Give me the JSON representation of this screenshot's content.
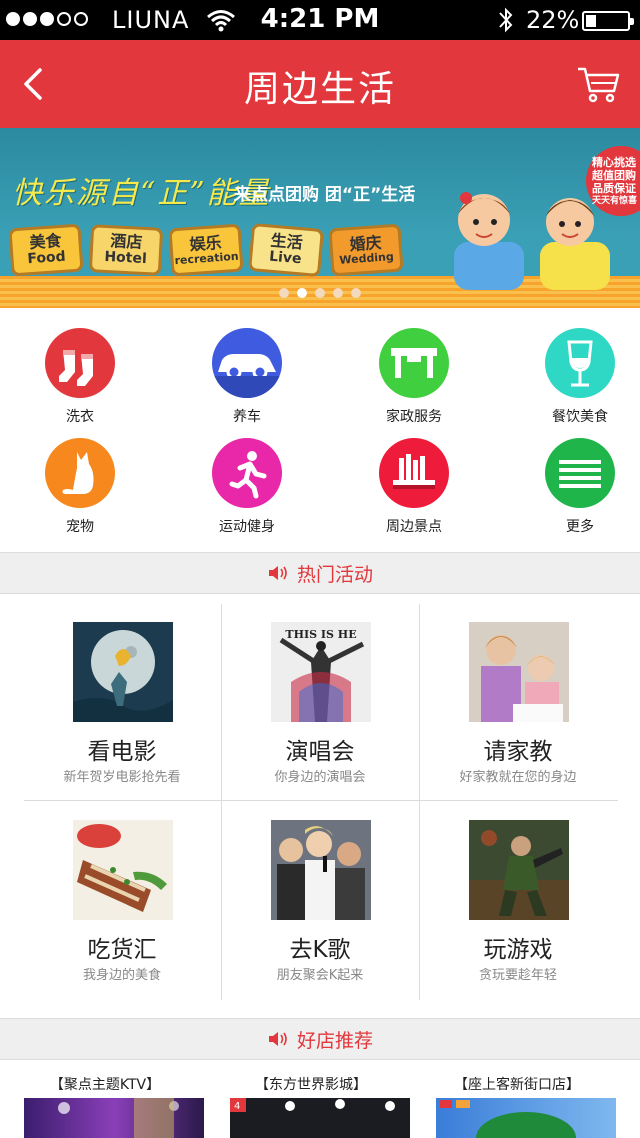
{
  "status_bar": {
    "carrier": "LIUNA",
    "time": "4:21 PM",
    "battery": "22%",
    "signal_strength": 3,
    "icons": [
      "wifi-icon",
      "bluetooth-icon",
      "battery-icon"
    ]
  },
  "nav": {
    "title": "周边生活",
    "back_icon": "back-arrow-icon",
    "cart_icon": "cart-icon"
  },
  "banner": {
    "slogan": "快乐源自“正”能量",
    "sub": "来点点团购 团“正”生活",
    "badge": [
      "精心挑选",
      "超值团购",
      "品质保证",
      "天天有惊喜"
    ],
    "tags": [
      {
        "cn": "美食",
        "en": "Food"
      },
      {
        "cn": "酒店",
        "en": "Hotel"
      },
      {
        "cn": "娱乐",
        "en": "recreation"
      },
      {
        "cn": "生活",
        "en": "Live"
      },
      {
        "cn": "婚庆",
        "en": "Wedding"
      }
    ],
    "pager_count": 5,
    "pager_active": 1
  },
  "categories": [
    {
      "label": "洗衣",
      "icon": "socks-icon",
      "color": "#e2373c"
    },
    {
      "label": "养车",
      "icon": "car-icon",
      "color": "#3f5ce0"
    },
    {
      "label": "家政服务",
      "icon": "table-icon",
      "color": "#3fcf3f"
    },
    {
      "label": "餐饮美食",
      "icon": "wine-glass-icon",
      "color": "#2ed8c4"
    },
    {
      "label": "宠物",
      "icon": "cat-icon",
      "color": "#f7881e"
    },
    {
      "label": "运动健身",
      "icon": "running-man-icon",
      "color": "#e827a9"
    },
    {
      "label": "周边景点",
      "icon": "bookshelf-icon",
      "color": "#ee1c3a"
    },
    {
      "label": "更多",
      "icon": "menu-lines-icon",
      "color": "#20b54a"
    }
  ],
  "hot_section": {
    "title": "热门活动",
    "icon": "speaker-icon"
  },
  "hot_items": [
    {
      "title": "看电影",
      "sub": "新年贺岁电影抢先看"
    },
    {
      "title": "演唱会",
      "sub": "你身边的演唱会",
      "img_text": "THIS IS HE"
    },
    {
      "title": "请家教",
      "sub": "好家教就在您的身边"
    },
    {
      "title": "吃货汇",
      "sub": "我身边的美食"
    },
    {
      "title": "去K歌",
      "sub": "朋友聚会K起来"
    },
    {
      "title": "玩游戏",
      "sub": "贪玩要趁年轻"
    }
  ],
  "shop_section": {
    "title": "好店推荐",
    "icon": "speaker-icon"
  },
  "shops": [
    {
      "name": "【聚点主题KTV】"
    },
    {
      "name": "【东方世界影城】"
    },
    {
      "name": "【座上客新街口店】"
    }
  ]
}
